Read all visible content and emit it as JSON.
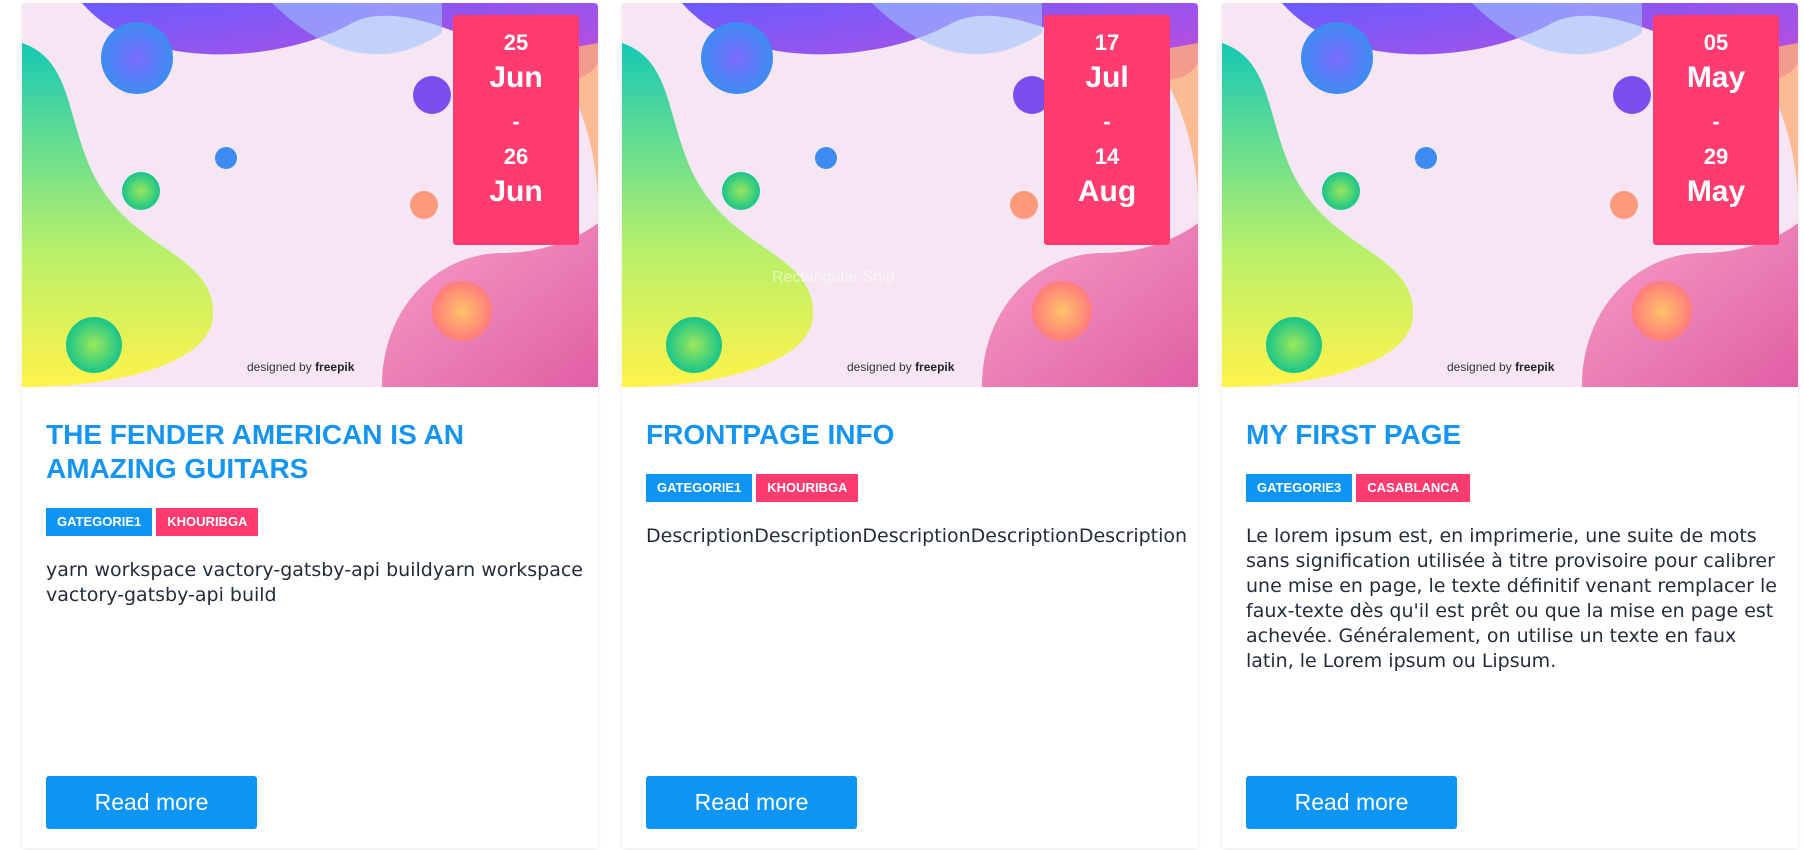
{
  "cards": [
    {
      "date": {
        "start_day": "25",
        "start_month": "Jun",
        "separator": "-",
        "end_day": "26",
        "end_month": "Jun"
      },
      "title": "THE FENDER AMERICAN IS AN AMAZING GUITARS",
      "category": "GATEGORIE1",
      "city": "KHOURIBGA",
      "description": "yarn workspace vactory-gatsby-api buildyarn workspace vactory-gatsby-api build",
      "read_more": "Read more",
      "credit_prefix": "designed by",
      "credit_brand": "freepik"
    },
    {
      "date": {
        "start_day": "17",
        "start_month": "Jul",
        "separator": "-",
        "end_day": "14",
        "end_month": "Aug"
      },
      "title": "FRONTPAGE INFO",
      "category": "GATEGORIE1",
      "city": "KHOURIBGA",
      "description": "DescriptionDescriptionDescriptionDescriptionDescription",
      "read_more": "Read more",
      "credit_prefix": "designed by",
      "credit_brand": "freepik",
      "image_overlay_text": "Rectangular Snip"
    },
    {
      "date": {
        "start_day": "05",
        "start_month": "May",
        "separator": "-",
        "end_day": "29",
        "end_month": "May"
      },
      "title": "MY FIRST PAGE",
      "category": "GATEGORIE3",
      "city": "CASABLANCA",
      "description": "Le lorem ipsum est, en imprimerie, une suite de mots sans signification utilisée à titre provisoire pour calibrer une mise en page, le texte définitif venant remplacer le faux-texte dès qu'il est prêt ou que la mise en page est achevée. Généralement, on utilise un texte en faux latin, le Lorem ipsum ou Lipsum.",
      "read_more": "Read more",
      "credit_prefix": "designed by",
      "credit_brand": "freepik"
    }
  ],
  "colors": {
    "accent_blue": "#0d95f5",
    "title_blue": "#1595f0",
    "accent_pink": "#ff3b6f",
    "text_dark": "#222d3a"
  }
}
